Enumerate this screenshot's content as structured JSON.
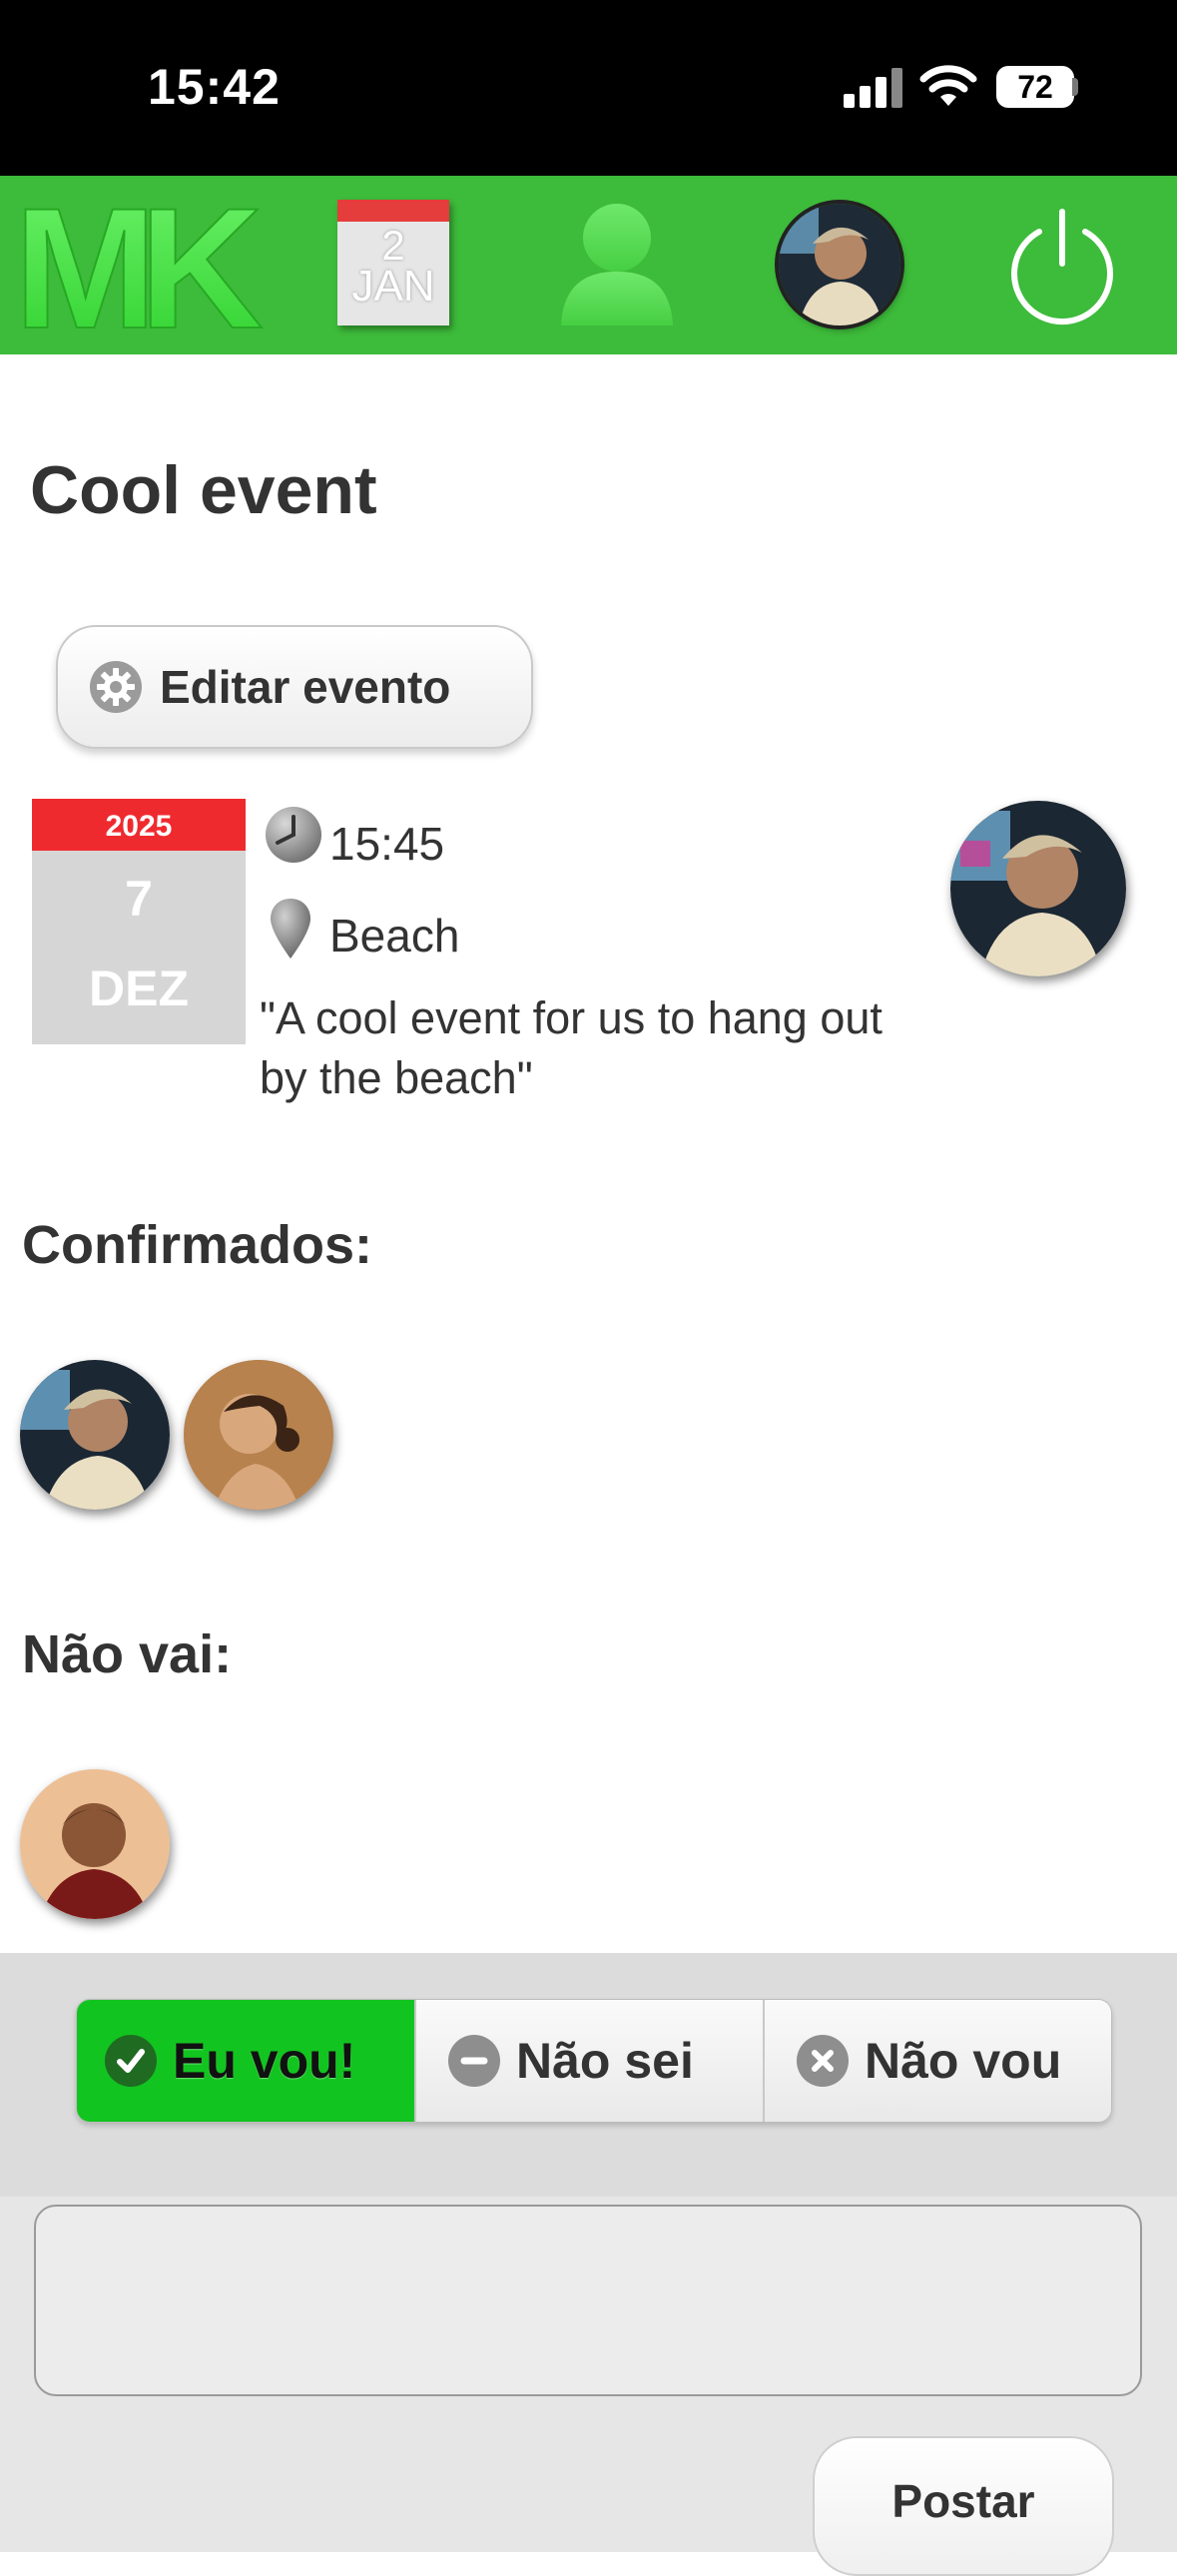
{
  "status_bar": {
    "time": "15:42",
    "battery": "72"
  },
  "header": {
    "logo_text": "MK",
    "calendar_day": "2",
    "calendar_month": "JAN",
    "accent_color": "#3dbb3a"
  },
  "event": {
    "title": "Cool event",
    "edit_label": "Editar evento",
    "date_year": "2025",
    "date_day": "7",
    "date_month": "DEZ",
    "time": "15:45",
    "location": "Beach",
    "description": "\"A cool event for us to hang out by the beach\""
  },
  "attendees": {
    "confirmed_title": "Confirmados:",
    "not_going_title": "Não vai:"
  },
  "rsvp": {
    "yes_label": "Eu vou!",
    "maybe_label": "Não sei",
    "no_label": "Não vou",
    "yes_color": "#12c41f"
  },
  "comment": {
    "placeholder": "",
    "post_label": "Postar"
  }
}
